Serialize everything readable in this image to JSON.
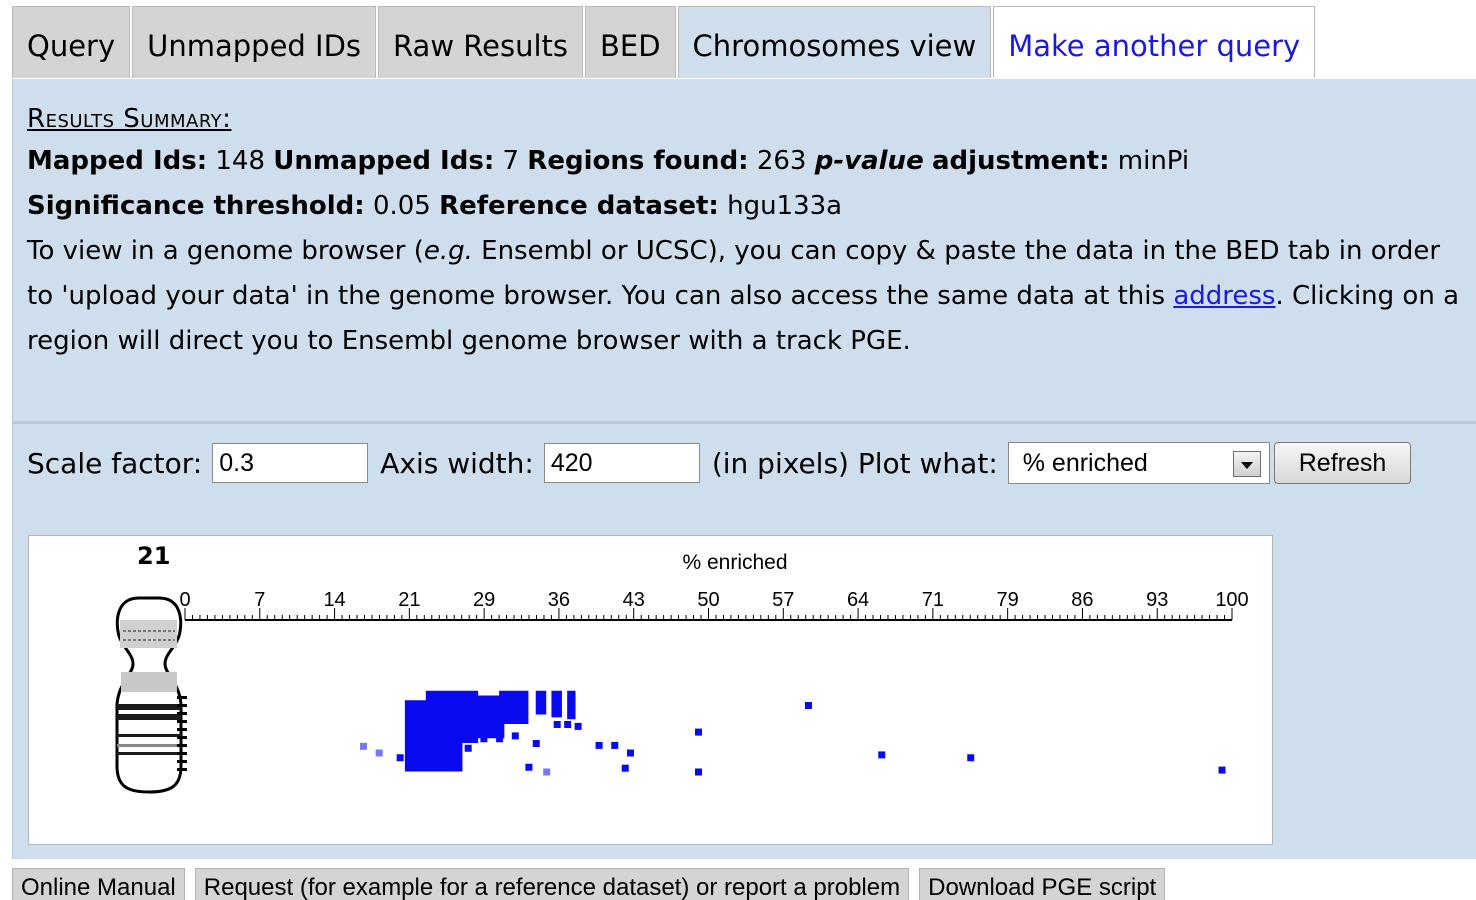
{
  "tabs": [
    {
      "label": "Query"
    },
    {
      "label": "Unmapped IDs"
    },
    {
      "label": "Raw Results"
    },
    {
      "label": "BED"
    },
    {
      "label": "Chromosomes view"
    },
    {
      "label": "Make another query"
    }
  ],
  "summary": {
    "title": "Results Summary:",
    "mapped_label": "Mapped Ids:",
    "mapped_value": "148",
    "unmapped_label": "Unmapped Ids:",
    "unmapped_value": "7",
    "regions_label": "Regions found:",
    "regions_value": "263",
    "pvalue_label": "p-value",
    "adjustment_label": "adjustment:",
    "adjustment_value": "minPi",
    "threshold_label": "Significance threshold:",
    "threshold_value": "0.05",
    "reference_label": "Reference dataset:",
    "reference_value": "hgu133a",
    "info_part1": "To view in a genome browser (",
    "info_eg": "e.g.",
    "info_part2": " Ensembl or UCSC), you can copy & paste the data in the BED tab in order to 'upload your data' in the genome browser. You can also access the same data at this ",
    "info_link": "address",
    "info_part3": ". Clicking on a region will direct you to Ensembl genome browser with a track PGE."
  },
  "controls": {
    "scale_label": "Scale factor:",
    "scale_value": "0.3",
    "axis_label": "Axis width:",
    "axis_value": "420",
    "pixels_label": "(in pixels) Plot what:",
    "plot_selected": "% enriched",
    "refresh_label": "Refresh"
  },
  "chart_data": {
    "type": "scatter",
    "title": "% enriched",
    "chromosome": "21",
    "xlim": [
      0,
      100
    ],
    "x_ticks": [
      "0",
      "7",
      "14",
      "21",
      "29",
      "36",
      "43",
      "50",
      "57",
      "64",
      "71",
      "79",
      "86",
      "93",
      "100"
    ],
    "colors": {
      "region": "#0a0af0",
      "region_light": "#7878f4"
    },
    "points": [
      {
        "x": 17.0,
        "y": 0.63,
        "light": true
      },
      {
        "x": 18.5,
        "y": 0.7,
        "light": true
      },
      {
        "x": 20.5,
        "y": 0.75
      },
      {
        "x": 22.0,
        "y": 0.7
      },
      {
        "x": 24.0,
        "y": 0.62
      },
      {
        "x": 25.5,
        "y": 0.58
      },
      {
        "x": 27.0,
        "y": 0.65
      },
      {
        "x": 28.5,
        "y": 0.55
      },
      {
        "x": 30.0,
        "y": 0.55
      },
      {
        "x": 31.5,
        "y": 0.52
      },
      {
        "x": 32.8,
        "y": 0.85
      },
      {
        "x": 33.5,
        "y": 0.6
      },
      {
        "x": 34.5,
        "y": 0.9,
        "light": true
      },
      {
        "x": 35.5,
        "y": 0.4
      },
      {
        "x": 36.5,
        "y": 0.4
      },
      {
        "x": 37.5,
        "y": 0.42
      },
      {
        "x": 39.5,
        "y": 0.62
      },
      {
        "x": 41.0,
        "y": 0.62
      },
      {
        "x": 42.0,
        "y": 0.86
      },
      {
        "x": 42.5,
        "y": 0.7
      },
      {
        "x": 49.0,
        "y": 0.48
      },
      {
        "x": 49.0,
        "y": 0.9
      },
      {
        "x": 59.5,
        "y": 0.2
      },
      {
        "x": 66.5,
        "y": 0.72
      },
      {
        "x": 75.0,
        "y": 0.75
      },
      {
        "x": 99.0,
        "y": 0.88
      }
    ]
  },
  "footer": [
    {
      "label": "Online Manual"
    },
    {
      "label": "Request (for example for a reference dataset) or report a problem"
    },
    {
      "label": "Download PGE script"
    }
  ]
}
